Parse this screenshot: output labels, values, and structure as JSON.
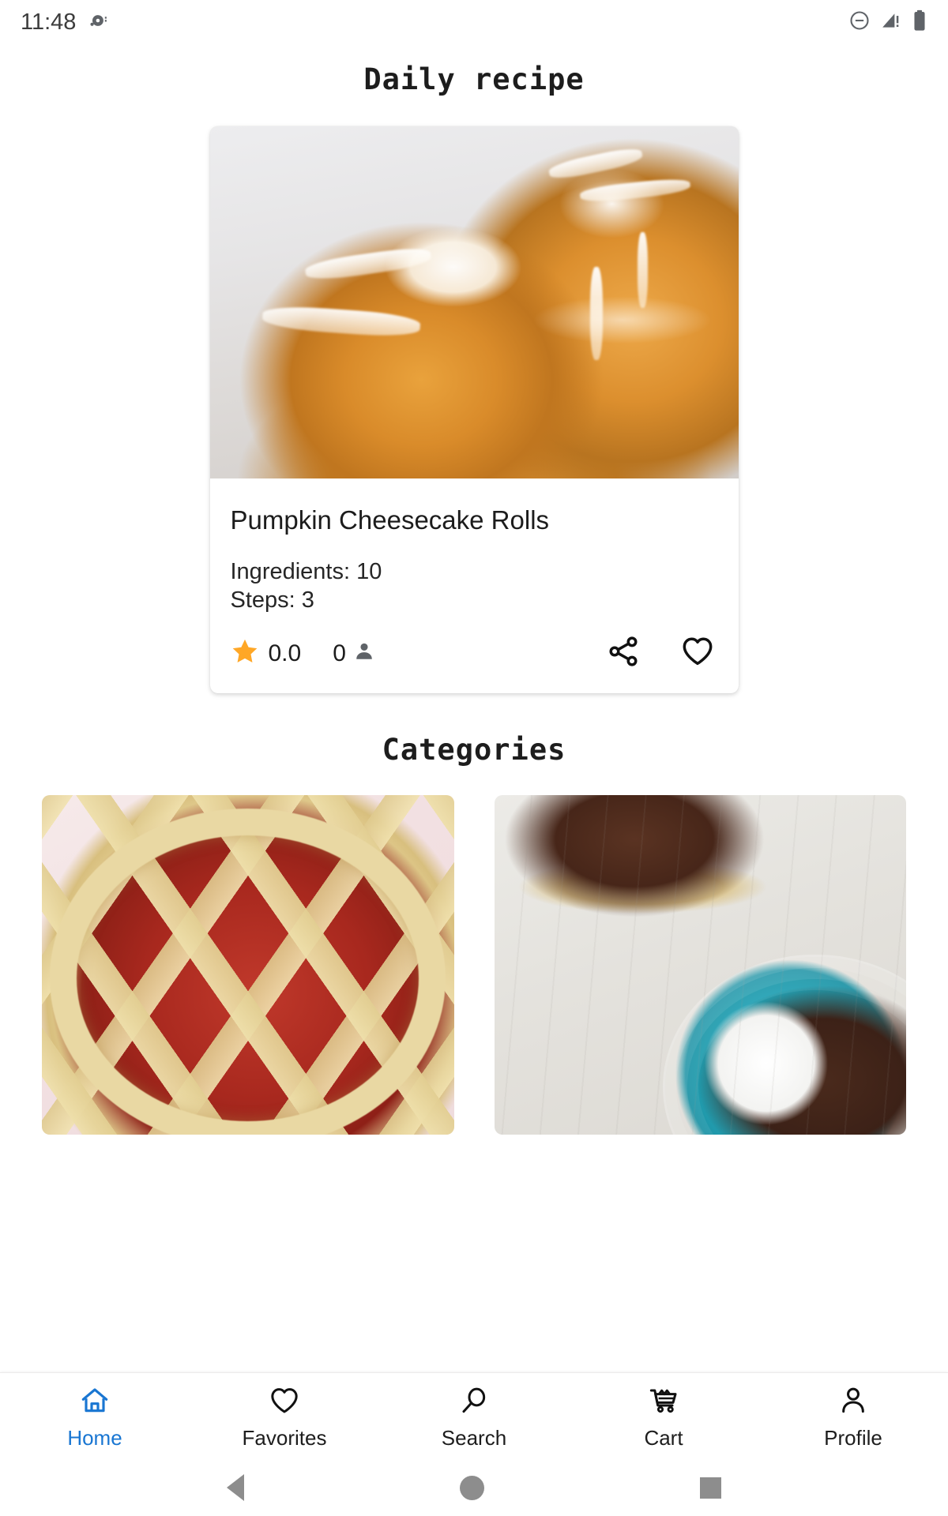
{
  "status_bar": {
    "time": "11:48",
    "left_icons": [
      "notification-dot-icon"
    ],
    "right_icons": [
      "do-not-disturb-icon",
      "cellular-signal-warning-icon",
      "battery-full-icon"
    ]
  },
  "daily_section": {
    "title": "Daily recipe"
  },
  "recipe_card": {
    "image_alt": "glazed-pumpkin-cheesecake-rolls-photo",
    "title": "Pumpkin Cheesecake Rolls",
    "ingredients_line": "Ingredients: 10",
    "steps_line": "Steps: 3",
    "rating_value": "0.0",
    "review_count": "0",
    "star_color": "#FFA726",
    "person_icon_color": "#5f6368",
    "share_icon": "share-icon",
    "favorite_icon": "heart-outline-icon"
  },
  "categories_section": {
    "title": "Categories",
    "tiles": [
      {
        "image_alt": "strawberry-lattice-pie-photo"
      },
      {
        "image_alt": "chocolate-pie-slice-on-teal-plate-photo"
      }
    ]
  },
  "bottom_nav": {
    "active_color": "#1976D2",
    "inactive_color": "#1D1D1D",
    "items": [
      {
        "label": "Home",
        "icon": "home-icon",
        "active": true
      },
      {
        "label": "Favorites",
        "icon": "heart-icon",
        "active": false
      },
      {
        "label": "Search",
        "icon": "search-icon",
        "active": false
      },
      {
        "label": "Cart",
        "icon": "cart-icon",
        "active": false
      },
      {
        "label": "Profile",
        "icon": "person-icon",
        "active": false
      }
    ]
  },
  "system_nav": {
    "back": "back-triangle-icon",
    "home": "home-circle-icon",
    "recents": "recents-square-icon",
    "color": "#8D8D8D"
  }
}
